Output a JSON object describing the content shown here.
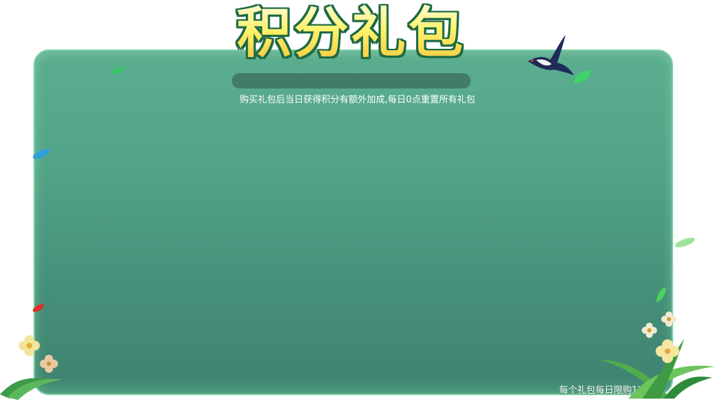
{
  "header": {
    "title": "积分礼包",
    "subtitle": "购买礼包后当日获得积分有额外加成,每日0点重置所有礼包"
  },
  "footer": {
    "limit_text": "每个礼包每日限购1次"
  },
  "decorations": {
    "bird_icon": "swallow-icon",
    "leaf_icon": "leaf-icon",
    "flower_icon": "flower-icon",
    "grass_icon": "grass-icon"
  },
  "colors": {
    "panel": "#54a58a",
    "title_fill": "#fff26a",
    "title_outline": "#1e6a44"
  }
}
